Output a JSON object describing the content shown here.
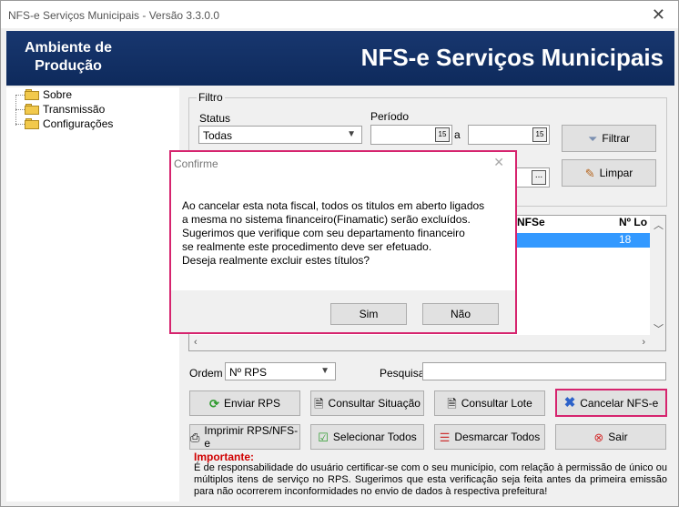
{
  "window": {
    "title": "NFS-e Serviços Municipais - Versão 3.3.0.0"
  },
  "banner": {
    "environment_line1": "Ambiente de",
    "environment_line2": "Produção",
    "title": "NFS-e Serviços Municipais"
  },
  "tree": {
    "items": [
      {
        "label": "Sobre"
      },
      {
        "label": "Transmissão"
      },
      {
        "label": "Configurações"
      }
    ]
  },
  "filter": {
    "group_label": "Filtro",
    "status_label": "Status",
    "status_value": "Todas",
    "period_label": "Período",
    "period_sep": "a",
    "filter_button": "Filtrar",
    "clear_button": "Limpar",
    "browse_button": "..."
  },
  "grid": {
    "columns": [
      "NFSe",
      "Nº Lo"
    ],
    "selected_row_value": "18"
  },
  "order": {
    "label": "Ordem",
    "value": "Nº RPS",
    "search_label": "Pesquisa",
    "search_value": ""
  },
  "actions": {
    "send_rps": "Enviar RPS",
    "check_status": "Consultar Situação",
    "check_batch": "Consultar Lote",
    "cancel_nfse": "Cancelar NFS-e",
    "print": "Imprimir RPS/NFS-e",
    "select_all": "Selecionar Todos",
    "deselect_all": "Desmarcar Todos",
    "exit": "Sair"
  },
  "warning": {
    "title": "Importante:",
    "text": "É de responsabilidade do usuário certificar-se com o seu município, com relação à permissão de único ou múltiplos itens de serviço no RPS. Sugerimos que esta verificação seja feita antes da primeira emissão para não ocorrerem inconformidades no envio de dados à respectiva prefeitura!"
  },
  "dialog": {
    "title": "Confirme",
    "lines": [
      "Ao cancelar esta nota fiscal, todos os titulos em aberto ligados",
      "a mesma no sistema financeiro(Finamatic) serão excluídos.",
      "Sugerimos que verifique com seu departamento financeiro",
      "se realmente este procedimento deve ser efetuado.",
      "Deseja realmente excluir estes títulos?"
    ],
    "yes": "Sim",
    "no": "Não"
  },
  "colors": {
    "banner": "#14306a",
    "accent_border": "#d6246e",
    "selection": "#3399ff",
    "warning": "#d00000"
  }
}
